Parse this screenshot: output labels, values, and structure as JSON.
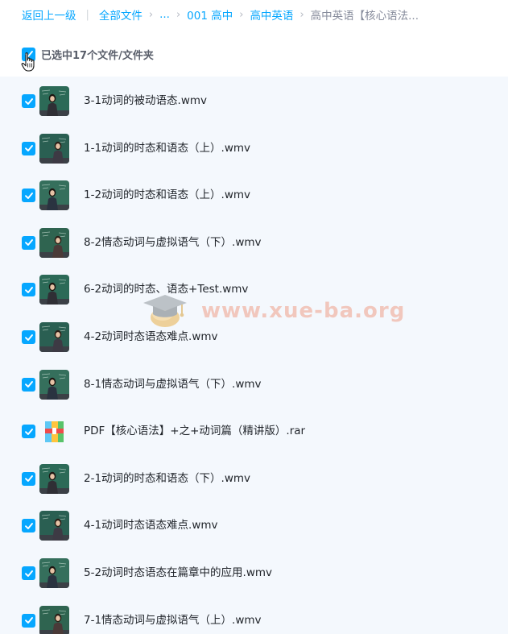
{
  "breadcrumb": {
    "back": "返回上一级",
    "all_files": "全部文件",
    "ellipsis": "...",
    "level1": "001 高中",
    "level2": "高中英语",
    "current": "高中英语【核心语法..."
  },
  "selection": {
    "label": "已选中17个文件/文件夹",
    "checked": true
  },
  "files": [
    {
      "name": "3-1动词的被动语态.wmv",
      "type": "video",
      "checked": true
    },
    {
      "name": "1-1动词的时态和语态（上）.wmv",
      "type": "video",
      "checked": true
    },
    {
      "name": "1-2动词的时态和语态（上）.wmv",
      "type": "video",
      "checked": true
    },
    {
      "name": "8-2情态动词与虚拟语气（下）.wmv",
      "type": "video",
      "checked": true
    },
    {
      "name": "6-2动词的时态、语态+Test.wmv",
      "type": "video",
      "checked": true
    },
    {
      "name": "4-2动词时态语态难点.wmv",
      "type": "video",
      "checked": true
    },
    {
      "name": "8-1情态动词与虚拟语气（下）.wmv",
      "type": "video",
      "checked": true
    },
    {
      "name": "PDF【核心语法】+之+动词篇（精讲版）.rar",
      "type": "archive",
      "checked": true
    },
    {
      "name": "2-1动词的时态和语态（下）.wmv",
      "type": "video",
      "checked": true
    },
    {
      "name": "4-1动词时态语态难点.wmv",
      "type": "video",
      "checked": true
    },
    {
      "name": "5-2动词时态语态在篇章中的应用.wmv",
      "type": "video",
      "checked": true
    },
    {
      "name": "7-1情态动词与虚拟语气（上）.wmv",
      "type": "video",
      "checked": true
    }
  ],
  "watermark": {
    "text": "www.xue-ba.org"
  },
  "colors": {
    "accent": "#06a7ff",
    "list_background": "#f4f8fd",
    "chalkboard": "#2e6b58"
  }
}
